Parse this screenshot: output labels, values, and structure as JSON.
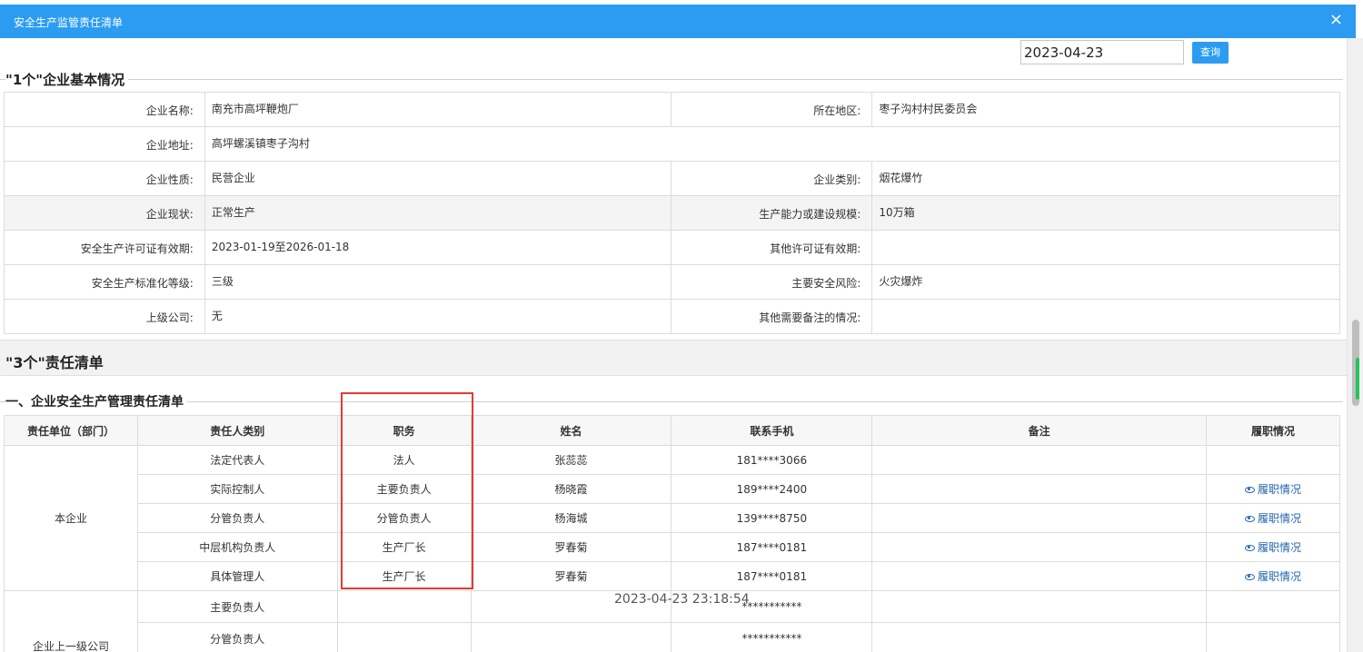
{
  "window": {
    "title": "安全生产监管责任清单",
    "close_glyph": "×"
  },
  "query": {
    "date_value": "2023-04-23",
    "button_label": "查询"
  },
  "section1": {
    "title": "\"1个\"企业基本情况"
  },
  "basic_info": {
    "rows": [
      {
        "l1": "企业名称:",
        "v1": "南充市高坪鞭炮厂",
        "l2": "所在地区:",
        "v2": "枣子沟村村民委员会"
      },
      {
        "l1": "企业地址:",
        "v1": "高坪螺溪镇枣子沟村"
      },
      {
        "l1": "企业性质:",
        "v1": "民营企业",
        "l2": "企业类别:",
        "v2": "烟花爆竹"
      },
      {
        "l1": "企业现状:",
        "v1": "正常生产",
        "l2": "生产能力或建设规模:",
        "v2": "10万箱"
      },
      {
        "l1": "安全生产许可证有效期:",
        "v1": "2023-01-19至2026-01-18",
        "l2": "其他许可证有效期:",
        "v2": ""
      },
      {
        "l1": "安全生产标准化等级:",
        "v1": "三级",
        "l2": "主要安全风险:",
        "v2": "火灾爆炸"
      },
      {
        "l1": "上级公司:",
        "v1": "无",
        "l2": "其他需要备注的情况:",
        "v2": ""
      }
    ]
  },
  "section2": {
    "title": "\"3个\"责任清单"
  },
  "subsection": {
    "title": "一、企业安全生产管理责任清单"
  },
  "resp_table": {
    "headers": [
      "责任单位（部门）",
      "责任人类别",
      "职务",
      "姓名",
      "联系手机",
      "备注",
      "履职情况"
    ],
    "group1": "本企业",
    "group2": "企业上一级公司",
    "duty_label": "履职情况",
    "rows": [
      {
        "cat": "法定代表人",
        "post": "法人",
        "name": "张蕊蕊",
        "phone": "181****3066",
        "note": "",
        "duty": ""
      },
      {
        "cat": "实际控制人",
        "post": "主要负责人",
        "name": "杨晓霞",
        "phone": "189****2400",
        "note": "",
        "duty": "履职情况"
      },
      {
        "cat": "分管负责人",
        "post": "分管负责人",
        "name": "杨海城",
        "phone": "139****8750",
        "note": "",
        "duty": "履职情况"
      },
      {
        "cat": "中层机构负责人",
        "post": "生产厂长",
        "name": "罗春菊",
        "phone": "187****0181",
        "note": "",
        "duty": "履职情况"
      },
      {
        "cat": "具体管理人",
        "post": "生产厂长",
        "name": "罗春菊",
        "phone": "187****0181",
        "note": "",
        "duty": "履职情况"
      },
      {
        "cat": "主要负责人",
        "post": "",
        "name": "",
        "phone": "***********",
        "note": "",
        "duty": ""
      },
      {
        "cat": "分管负责人",
        "post": "",
        "name": "",
        "phone": "***********",
        "note": "",
        "duty": ""
      }
    ]
  },
  "watermark": "2023-04-23 23:18:54",
  "colors": {
    "titlebar": "#2c9cf2",
    "highlight_box": "#e53935",
    "link": "#2266aa"
  }
}
